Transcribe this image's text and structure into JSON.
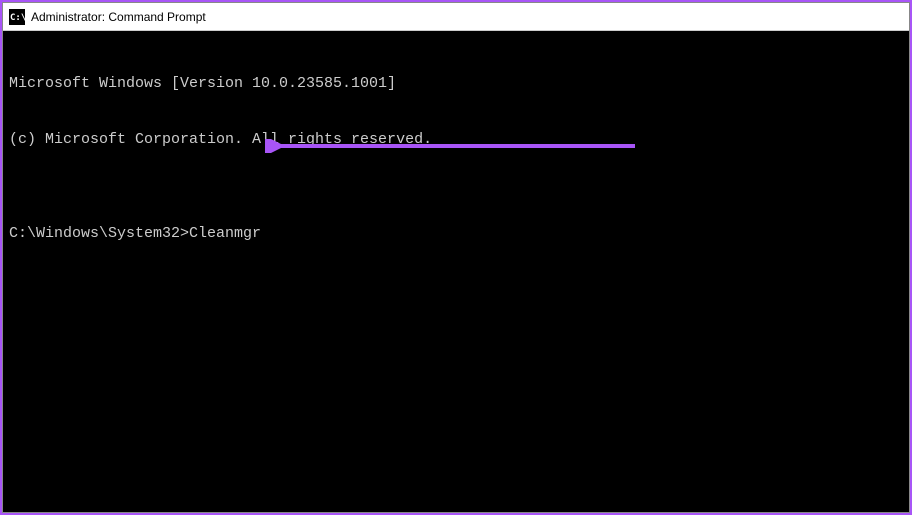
{
  "titlebar": {
    "title": "Administrator: Command Prompt"
  },
  "terminal": {
    "line1": "Microsoft Windows [Version 10.0.23585.1001]",
    "line2": "(c) Microsoft Corporation. All rights reserved.",
    "blank": "",
    "prompt": "C:\\Windows\\System32>",
    "command": "Cleanmgr"
  },
  "annotation": {
    "arrow_color": "#a855f7"
  }
}
